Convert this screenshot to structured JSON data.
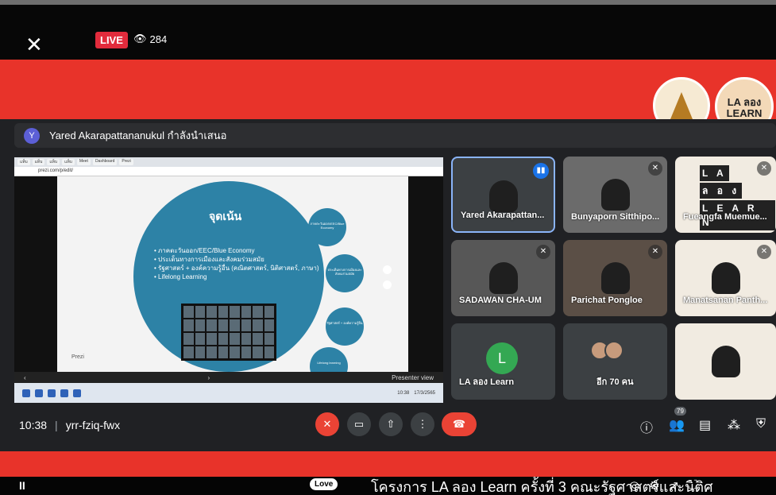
{
  "stream": {
    "live_label": "LIVE",
    "viewer_count": "284",
    "close_icon": "✕",
    "eye_icon": "👁"
  },
  "banner": {
    "logo2_text": "LA ลอง LEARN"
  },
  "meet": {
    "presenter_initial": "Y",
    "presenter_text": "Yared Akarapattananukul กำลังนำเสนอ",
    "clock": "10:38",
    "meeting_code": "yrr-fziq-fwx",
    "participant_badge": "79"
  },
  "slide": {
    "title": "จุดเน้น",
    "bullets": [
      "• ภาคตะวันออก/EEC/Blue Economy",
      "• ประเด็นทางการเมืองและสังคมร่วมสมัย",
      "• รัฐศาสตร์ + องค์ความรู้อื่น (คณิตศาสตร์, นิติศาสตร์, ภาษา)",
      "• Lifelong Learning"
    ],
    "side_circles": [
      "ภาคตะวันออก/EEC/Blue Economy",
      "ประเด็นทางการเมืองและสังคมร่วมสมัย",
      "รัฐศาสตร์ + องค์ความรู้อื่น",
      "Lifelong learning"
    ],
    "prezi_label": "Prezi",
    "presenter_view": "Presenter view",
    "browser_url": "prezi.com/p/edit/",
    "taskbar_time": "10:38",
    "taskbar_date": "17/3/2565"
  },
  "tiles": [
    {
      "name": "Yared Akarapattan..."
    },
    {
      "name": "Bunyaporn Sitthipo..."
    },
    {
      "name": "Fueangfa Muemue..."
    },
    {
      "name": "SADAWAN CHA-UM"
    },
    {
      "name": "Parichat Pongloe"
    },
    {
      "name": "Manatsanan Panth..."
    },
    {
      "name": "LA ลอง Learn",
      "initial": "L"
    },
    {
      "name": "อีก 70 คน"
    }
  ],
  "poster_letters": [
    "L A",
    "ล อ ง",
    "L E A R N"
  ],
  "player": {
    "pause_icon": "II",
    "love_label": "Love",
    "caption": "โครงการ LA ลอง Learn ครั้งที่ 3 คณะรัฐศาสตร์และนิติศ"
  },
  "colors": {
    "live": "#e22b3c",
    "banner_red": "#e8332a",
    "meet_bg": "#202124",
    "slide_blue": "#2d82a6",
    "hangup": "#ea4335"
  }
}
